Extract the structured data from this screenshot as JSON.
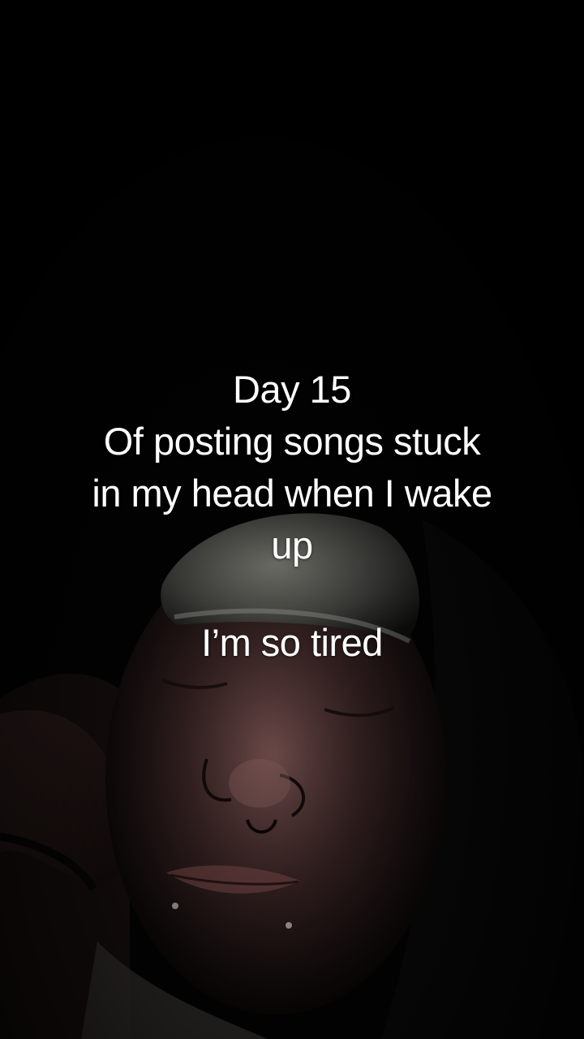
{
  "caption": {
    "lines": [
      "Day 15",
      "Of posting songs stuck",
      "in my head when I wake",
      "up"
    ],
    "closing": "I’m so tired"
  },
  "colors": {
    "background": "#020202",
    "caption_text": "#ffffff",
    "skin_tone": "#5a3c3c",
    "hat": "#6f6f69"
  }
}
